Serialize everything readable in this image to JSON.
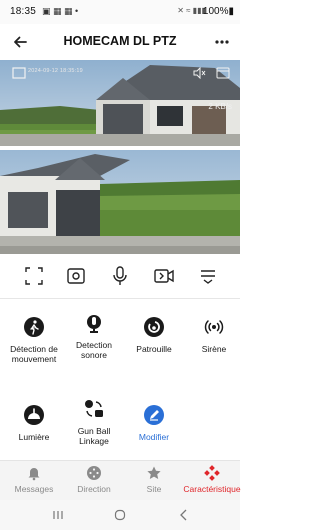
{
  "status_bar": {
    "time": "18:35",
    "notification_icons": "▣ ▦ ▦ •",
    "system_icons": "✕ ≈ ▮▮▮",
    "battery": "100%▮"
  },
  "app_bar": {
    "title": "HOMECAM DL PTZ",
    "back_icon": "arrow-left",
    "more_icon": "more-horizontal"
  },
  "camera_view": {
    "osd_timestamp": "2024-09-12 18:35:19",
    "speed": "2 KB/s",
    "buttons": [
      "fullscreen-toggle",
      "mute",
      "record"
    ]
  },
  "controls": [
    {
      "name": "fullscreen",
      "icon": "fullscreen-icon"
    },
    {
      "name": "snapshot",
      "icon": "snapshot-icon"
    },
    {
      "name": "microphone",
      "icon": "microphone-icon"
    },
    {
      "name": "record",
      "icon": "video-record-icon"
    },
    {
      "name": "menu",
      "icon": "menu-icon"
    }
  ],
  "features": [
    {
      "label": "Détection de mouvement",
      "icon": "walk-icon",
      "color": "#1a1a1a"
    },
    {
      "label": "Detection sonore",
      "icon": "mic-circle-icon",
      "color": "#1a1a1a"
    },
    {
      "label": "Patrouille",
      "icon": "patrol-icon",
      "color": "#1a1a1a"
    },
    {
      "label": "Sirène",
      "icon": "siren-icon",
      "color": "#1a1a1a"
    },
    {
      "label": "Lumière",
      "icon": "light-icon",
      "color": "#1a1a1a"
    },
    {
      "label": "Gun Ball Linkage",
      "icon": "link-camera-icon",
      "color": "#1a1a1a"
    },
    {
      "label": "Modifier",
      "icon": "edit-icon",
      "color": "#2a6fd6"
    }
  ],
  "tabs": [
    {
      "label": "Messages",
      "icon": "bell-icon",
      "active": false
    },
    {
      "label": "Direction",
      "icon": "dpad-icon",
      "active": false
    },
    {
      "label": "Site",
      "icon": "star-icon",
      "active": false
    },
    {
      "label": "Caractéristique",
      "icon": "features-icon",
      "active": true
    }
  ],
  "colors": {
    "accent_red": "#e0262b",
    "accent_blue": "#2a6fd6",
    "inactive_tab": "#8a8a8a"
  }
}
